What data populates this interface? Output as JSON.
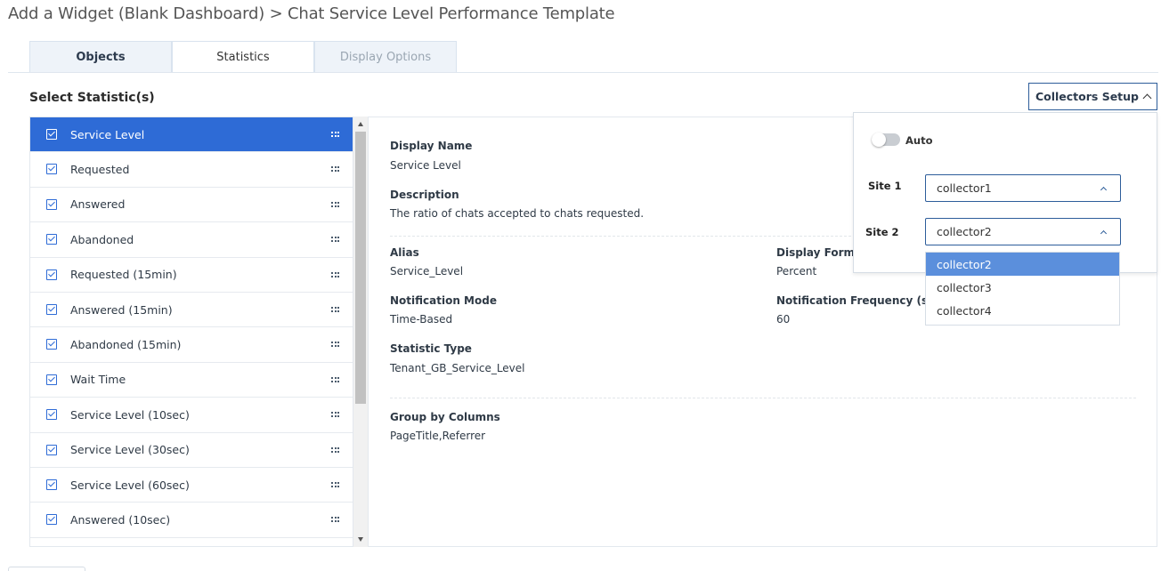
{
  "breadcrumb": "Add a Widget (Blank Dashboard) > Chat Service Level Performance Template",
  "tabs": [
    {
      "label": "Objects",
      "state": "normal"
    },
    {
      "label": "Statistics",
      "state": "active"
    },
    {
      "label": "Display Options",
      "state": "disabled"
    }
  ],
  "select_title": "Select Statistic(s)",
  "collectors_button": "Collectors Setup",
  "statistics": [
    {
      "label": "Service Level",
      "checked": true,
      "selected": true
    },
    {
      "label": "Requested",
      "checked": true,
      "selected": false
    },
    {
      "label": "Answered",
      "checked": true,
      "selected": false
    },
    {
      "label": "Abandoned",
      "checked": true,
      "selected": false
    },
    {
      "label": "Requested (15min)",
      "checked": true,
      "selected": false
    },
    {
      "label": "Answered (15min)",
      "checked": true,
      "selected": false
    },
    {
      "label": "Abandoned (15min)",
      "checked": true,
      "selected": false
    },
    {
      "label": "Wait Time",
      "checked": true,
      "selected": false
    },
    {
      "label": "Service Level (10sec)",
      "checked": true,
      "selected": false
    },
    {
      "label": "Service Level (30sec)",
      "checked": true,
      "selected": false
    },
    {
      "label": "Service Level (60sec)",
      "checked": true,
      "selected": false
    },
    {
      "label": "Answered (10sec)",
      "checked": true,
      "selected": false
    }
  ],
  "details": {
    "display_name_label": "Display Name",
    "display_name_value": "Service Level",
    "description_label": "Description",
    "description_value": "The ratio of chats accepted to chats requested.",
    "alias_label": "Alias",
    "alias_value": "Service_Level",
    "display_format_label": "Display Format",
    "display_format_value": "Percent",
    "notification_mode_label": "Notification Mode",
    "notification_mode_value": "Time-Based",
    "notification_frequency_label": "Notification Frequency (second",
    "notification_frequency_value": "60",
    "statistic_type_label": "Statistic Type",
    "statistic_type_value": "Tenant_GB_Service_Level",
    "group_by_label": "Group by Columns",
    "group_by_value": "PageTitle,Referrer"
  },
  "collectors_panel": {
    "auto_label": "Auto",
    "auto_on": false,
    "site1_label": "Site 1",
    "site1_value": "collector1",
    "site2_label": "Site 2",
    "site2_value": "collector2",
    "dropdown_options": [
      "collector2",
      "collector3",
      "collector4"
    ],
    "highlighted_option": "collector2"
  },
  "colors": {
    "accent": "#2e6bd6",
    "highlight": "#5b8fdc"
  }
}
